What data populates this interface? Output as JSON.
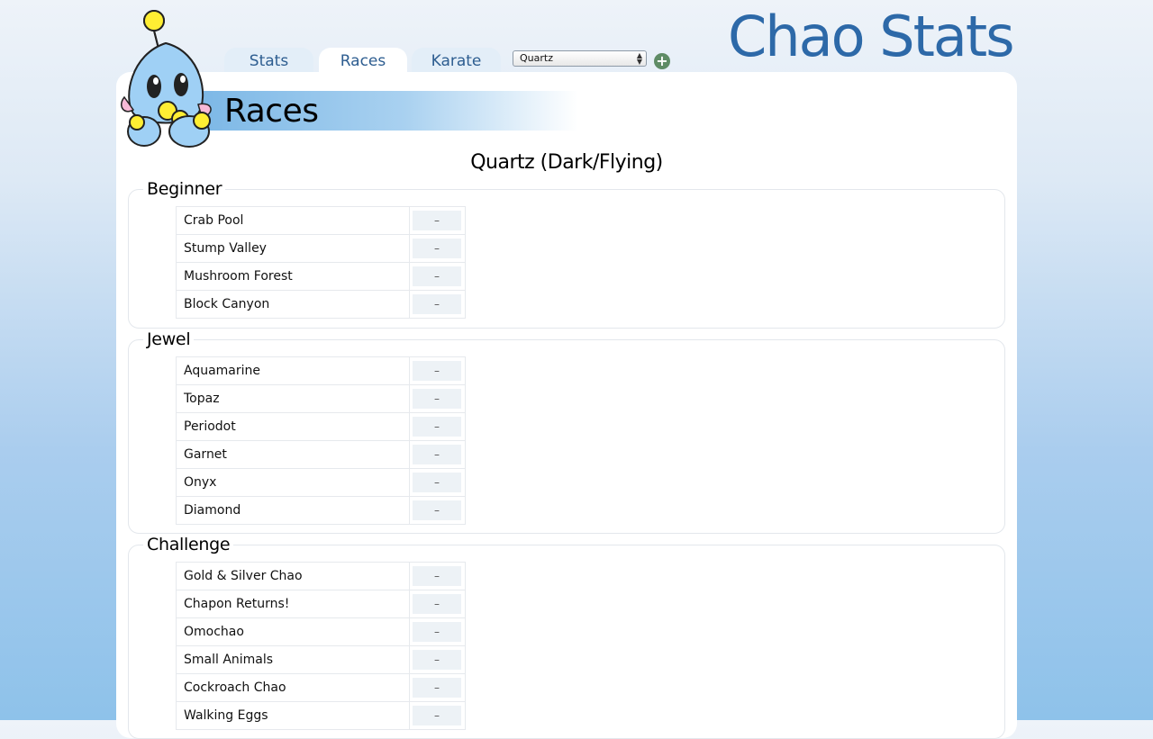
{
  "app": {
    "title": "Chao Stats"
  },
  "tabs": [
    {
      "label": "Stats"
    },
    {
      "label": "Races"
    },
    {
      "label": "Karate"
    }
  ],
  "chao_select": {
    "selected": "Quartz"
  },
  "add_button": {
    "label": "+"
  },
  "page": {
    "heading": "Races",
    "chao_name": "Quartz (Dark/Flying)"
  },
  "groups": [
    {
      "title": "Beginner",
      "races": [
        {
          "name": "Crab Pool",
          "value": "–"
        },
        {
          "name": "Stump Valley",
          "value": "–"
        },
        {
          "name": "Mushroom Forest",
          "value": "–"
        },
        {
          "name": "Block Canyon",
          "value": "–"
        }
      ]
    },
    {
      "title": "Jewel",
      "races": [
        {
          "name": "Aquamarine",
          "value": "–"
        },
        {
          "name": "Topaz",
          "value": "–"
        },
        {
          "name": "Periodot",
          "value": "–"
        },
        {
          "name": "Garnet",
          "value": "–"
        },
        {
          "name": "Onyx",
          "value": "–"
        },
        {
          "name": "Diamond",
          "value": "–"
        }
      ]
    },
    {
      "title": "Challenge",
      "races": [
        {
          "name": "Gold & Silver Chao",
          "value": "–"
        },
        {
          "name": "Chapon Returns!",
          "value": "–"
        },
        {
          "name": "Omochao",
          "value": "–"
        },
        {
          "name": "Small Animals",
          "value": "–"
        },
        {
          "name": "Cockroach Chao",
          "value": "–"
        },
        {
          "name": "Walking Eggs",
          "value": "–"
        }
      ]
    }
  ],
  "colors": {
    "title": "#2d69a8",
    "tab_text": "#2d5d90",
    "banner": "#7bb7e6",
    "add_button": "#5f8c66"
  }
}
